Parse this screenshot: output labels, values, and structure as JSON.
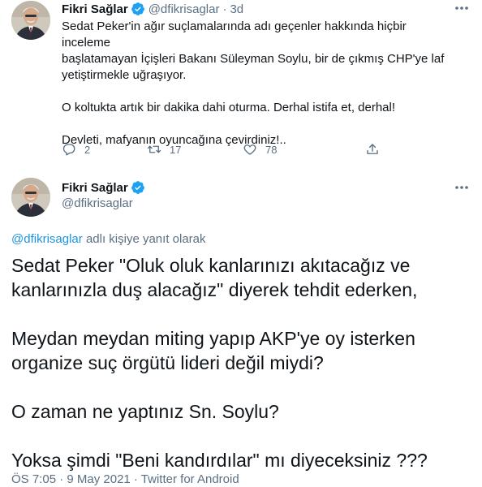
{
  "parent_tweet": {
    "name": "Fikri Sağlar",
    "handle": "@dfikrisaglar",
    "separator": "·",
    "time": "3d",
    "body_lines": [
      "Sedat Peker'in ağır suçlamalarında adı geçenler hakkında hiçbir inceleme",
      "başlatamayan İçişleri Bakanı Süleyman Soylu, bir de çıkmış CHP'ye laf",
      "yetiştirmekle uğraşıyor.",
      "O koltukta artık bir dakika dahi oturma. Derhal istifa et, derhal!",
      "Devleti, mafyanın oyuncağına çevirdiniz!.."
    ],
    "replies": "2",
    "retweets": "17",
    "likes": "78"
  },
  "main_tweet": {
    "name": "Fikri Sağlar",
    "handle": "@dfikrisaglar",
    "reply_mention": "@dfikrisaglar",
    "reply_suffix": "adlı kişiye yanıt olarak",
    "body_lines": [
      "Sedat Peker \"Oluk oluk kanlarınızı akıtacağız ve",
      "kanlarınızla duş alacağız\" diyerek tehdit ederken,",
      "Meydan meydan miting yapıp AKP'ye oy isterken",
      "organize suç örgütü lideri değil miydi?",
      "O zaman ne yaptınız Sn. Soylu?",
      "Yoksa şimdi \"Beni kandırdılar\" mı diyeceksiniz ???"
    ],
    "meta": "ÖS 7:05 · 9 May 2021 · Twitter for Android"
  },
  "icons": {
    "verified": "verified-badge-icon",
    "more": "more-options-icon",
    "reply": "reply-icon",
    "retweet": "retweet-icon",
    "like": "like-icon",
    "share": "share-icon"
  },
  "colors": {
    "text": "#0f1419",
    "secondary": "#5b7083",
    "accent": "#1da1f2",
    "mention": "#1b95e0"
  }
}
